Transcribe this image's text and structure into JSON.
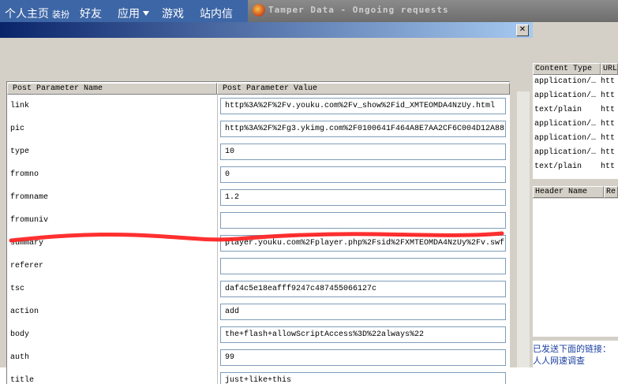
{
  "site_nav": {
    "items": [
      {
        "label": "个人主页"
      },
      {
        "label": "装扮"
      },
      {
        "label": "好友"
      },
      {
        "label": "应用"
      },
      {
        "label": "游戏"
      },
      {
        "label": "站内信"
      }
    ]
  },
  "tamper_window": {
    "title": "Tamper Data - Ongoing requests"
  },
  "dialog": {
    "close_label": "✕",
    "columns": [
      "Post Parameter Name",
      "Post Parameter Value"
    ],
    "params": [
      {
        "name": "link",
        "value": "http%3A%2F%2Fv.youku.com%2Fv_show%2Fid_XMTEOMDA4NzUy.html"
      },
      {
        "name": "pic",
        "value": "http%3A%2F%2Fg3.ykimg.com%2F0100641F464A8E7AA2CF6C004D12A88"
      },
      {
        "name": "type",
        "value": "10"
      },
      {
        "name": "fromno",
        "value": "0"
      },
      {
        "name": "fromname",
        "value": "1.2"
      },
      {
        "name": "fromuniv",
        "value": ""
      },
      {
        "name": "summary",
        "value": "player.youku.com%2Fplayer.php%2Fsid%2FXMTEOMDA4NzUy%2Fv.swf"
      },
      {
        "name": "referer",
        "value": ""
      },
      {
        "name": "tsc",
        "value": "daf4c5e18eafff9247c487455066127c"
      },
      {
        "name": "action",
        "value": "add"
      },
      {
        "name": "body",
        "value": "the+flash+allowScriptAccess%3D%22always%22"
      },
      {
        "name": "auth",
        "value": "99"
      },
      {
        "name": "title",
        "value": "just+like+this"
      }
    ]
  },
  "requests_panel": {
    "columns": [
      "Content Type",
      "URL"
    ],
    "rows": [
      {
        "content_type": "application/…",
        "url": "htt"
      },
      {
        "content_type": "application/…",
        "url": "htt"
      },
      {
        "content_type": "text/plain",
        "url": "htt"
      },
      {
        "content_type": "application/…",
        "url": "htt"
      },
      {
        "content_type": "application/…",
        "url": "htt"
      },
      {
        "content_type": "application/…",
        "url": "htt"
      },
      {
        "content_type": "text/plain",
        "url": "htt"
      }
    ],
    "header_columns": [
      "Header Name",
      "Re"
    ]
  },
  "bottom_text": {
    "line1": "已发送下面的链接：",
    "line2": "人人网速调查"
  },
  "colors": {
    "nav_bg": "#3d66a6",
    "dialog_title_gradient_start": "#0a246a",
    "dialog_title_gradient_end": "#a6caf0",
    "highlight_stroke": "#ff1a1a"
  }
}
